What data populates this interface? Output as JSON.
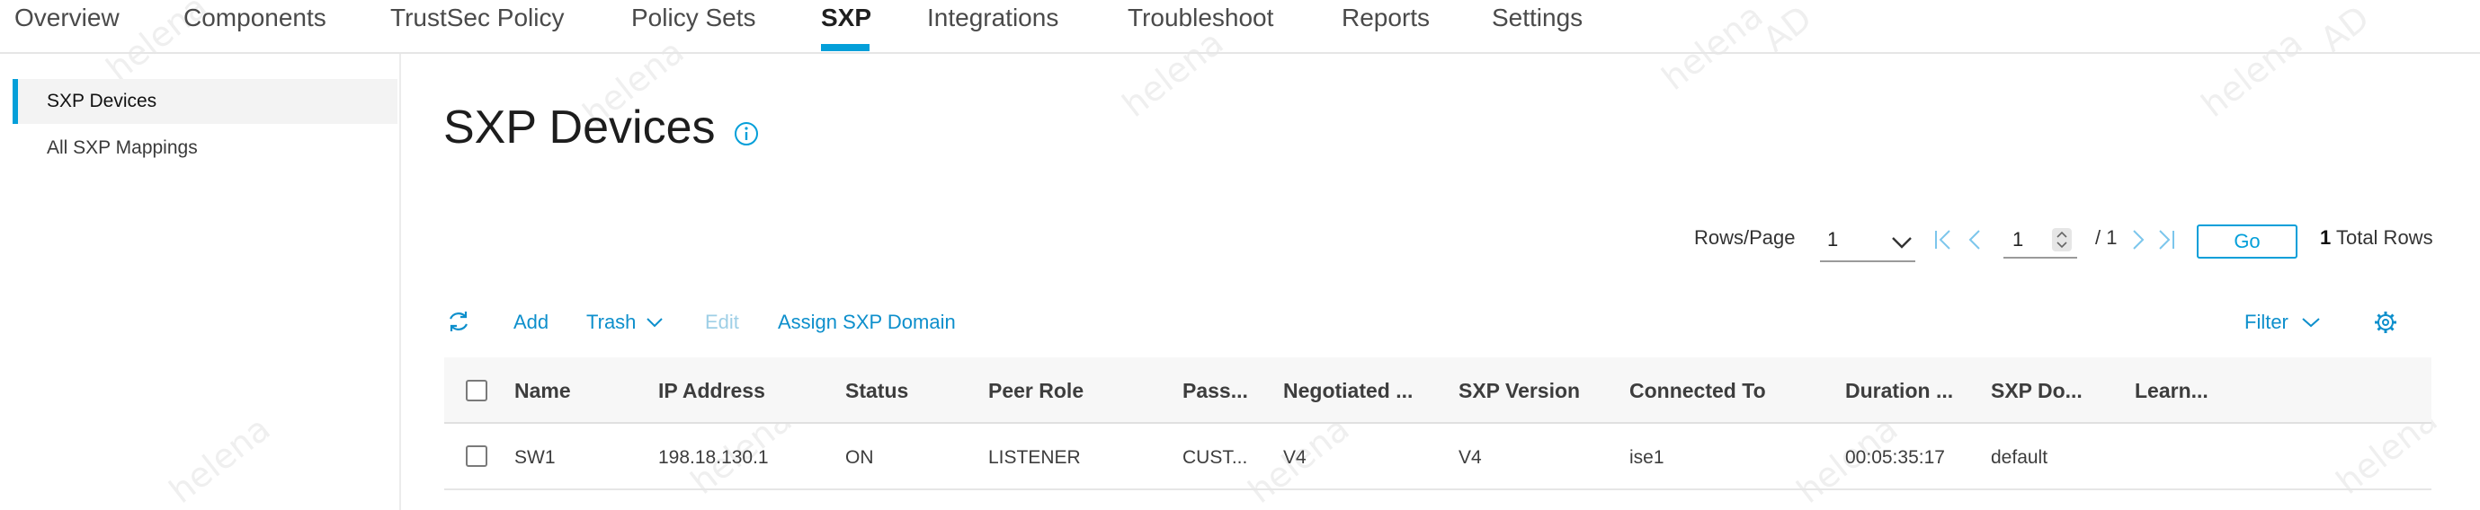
{
  "topnav": {
    "tabs": [
      {
        "label": "Overview",
        "active": false
      },
      {
        "label": "Components",
        "active": false
      },
      {
        "label": "TrustSec Policy",
        "active": false
      },
      {
        "label": "Policy Sets",
        "active": false
      },
      {
        "label": "SXP",
        "active": true
      },
      {
        "label": "Integrations",
        "active": false
      },
      {
        "label": "Troubleshoot",
        "active": false
      },
      {
        "label": "Reports",
        "active": false
      },
      {
        "label": "Settings",
        "active": false
      }
    ]
  },
  "sidebar": {
    "items": [
      {
        "label": "SXP Devices",
        "active": true
      },
      {
        "label": "All SXP Mappings",
        "active": false
      }
    ]
  },
  "page": {
    "title": "SXP Devices",
    "info_icon": "info-circle-icon"
  },
  "pagination": {
    "rows_per_page_label": "Rows/Page",
    "rows_per_page_value": "1",
    "current_page": "1",
    "page_total": "/ 1",
    "go_label": "Go",
    "total_count": "1",
    "total_label": "Total Rows"
  },
  "toolbar": {
    "refresh_icon": "refresh-icon",
    "add_label": "Add",
    "trash_label": "Trash",
    "edit_label": "Edit",
    "assign_label": "Assign SXP Domain",
    "filter_label": "Filter",
    "settings_icon": "gear-icon"
  },
  "table": {
    "columns": [
      "Name",
      "IP Address",
      "Status",
      "Peer Role",
      "Pass...",
      "Negotiated ...",
      "SXP Version",
      "Connected To",
      "Duration ...",
      "SXP Do...",
      "Learn..."
    ],
    "rows": [
      [
        "SW1",
        "198.18.130.1",
        "ON",
        "LISTENER",
        "CUST...",
        "V4",
        "V4",
        "ise1",
        "00:05:35:17",
        "default",
        ""
      ]
    ]
  },
  "watermark": {
    "text_user": "helena",
    "text_ad": "AD"
  },
  "colors": {
    "accent": "#049fd9",
    "link": "#0d8fcc"
  }
}
